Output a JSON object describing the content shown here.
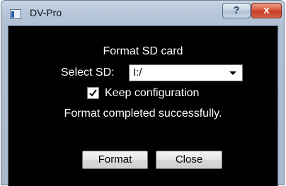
{
  "window": {
    "title": "DV-Pro",
    "help_label": "?",
    "close_label": "x"
  },
  "dialog": {
    "heading": "Format SD card",
    "select_label": "Select SD:",
    "select_value": "I:/",
    "keep_config_label": "Keep configuration",
    "keep_config_checked": true,
    "status": "Format completed successfully.",
    "format_label": "Format",
    "close_label": "Close"
  },
  "colors": {
    "content_bg": "#000000",
    "text": "#ffffff",
    "close_button": "#c63c20"
  },
  "icons": {
    "app": "app-icon",
    "dropdown": "chevron-down-icon",
    "check": "checkmark-icon"
  }
}
